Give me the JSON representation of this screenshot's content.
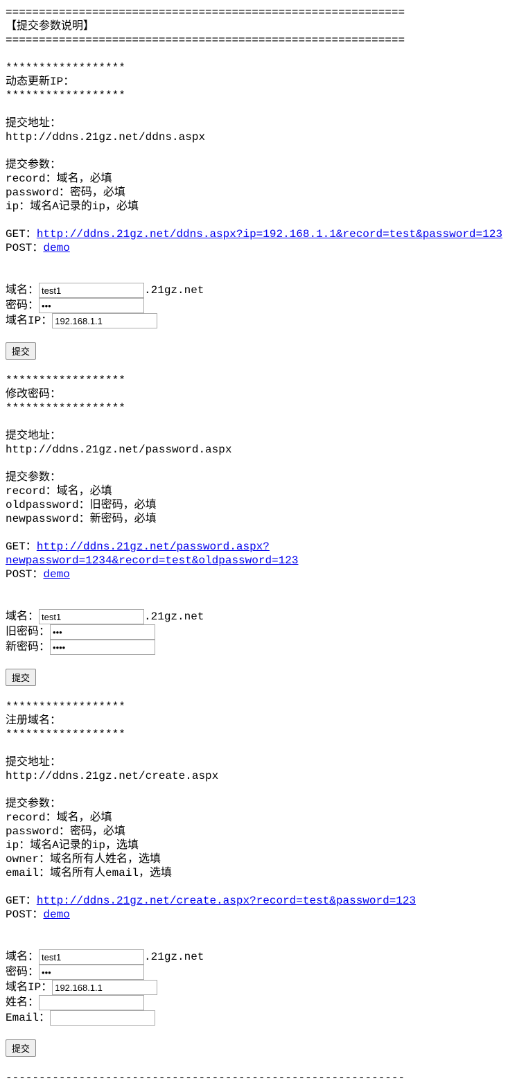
{
  "header": {
    "rule1": "============================================================",
    "title": "【提交参数说明】",
    "rule2": "============================================================"
  },
  "stars": "******************",
  "submitAddrLabel": "提交地址：",
  "submitParamsLabel": "提交参数：",
  "getLabel": "GET：",
  "postLabel": "POST：",
  "demoLabel": "demo",
  "submitButton": "提交",
  "suffix": ".21gz.net",
  "sec1": {
    "title": "动态更新IP：",
    "addr": "http://ddns.21gz.net/ddns.aspx",
    "params": [
      "record：域名，必填",
      "password：密码，必填",
      "ip：域名A记录的ip，必填"
    ],
    "getUrl": "http://ddns.21gz.net/ddns.aspx?ip=192.168.1.1&record=test&password=123",
    "form": {
      "domainLabel": "域名：",
      "domainValue": "test1",
      "passwordLabel": "密码：",
      "passwordValue": "123",
      "ipLabel": "域名IP：",
      "ipValue": "192.168.1.1"
    }
  },
  "sec2": {
    "title": "修改密码：",
    "addr": "http://ddns.21gz.net/password.aspx",
    "params": [
      "record：域名，必填",
      "oldpassword：旧密码，必填",
      "newpassword：新密码，必填"
    ],
    "getUrl": "http://ddns.21gz.net/password.aspx?newpassword=1234&record=test&oldpassword=123",
    "form": {
      "domainLabel": "域名：",
      "domainValue": "test1",
      "oldPasswordLabel": "旧密码：",
      "oldPasswordValue": "123",
      "newPasswordLabel": "新密码：",
      "newPasswordValue": "1234"
    }
  },
  "sec3": {
    "title": "注册域名：",
    "addr": "http://ddns.21gz.net/create.aspx",
    "params": [
      "record：域名，必填",
      "password：密码，必填",
      "ip：域名A记录的ip，选填",
      "owner：域名所有人姓名，选填",
      "email：域名所有人email，选填"
    ],
    "getUrl": "http://ddns.21gz.net/create.aspx?record=test&password=123",
    "form": {
      "domainLabel": "域名：",
      "domainValue": "test1",
      "passwordLabel": "密码：",
      "passwordValue": "123",
      "ipLabel": "域名IP：",
      "ipValue": "192.168.1.1",
      "nameLabel": "姓名：",
      "nameValue": "",
      "emailLabel": "Email：",
      "emailValue": ""
    }
  },
  "footerRule": "------------------------------------------------------------"
}
